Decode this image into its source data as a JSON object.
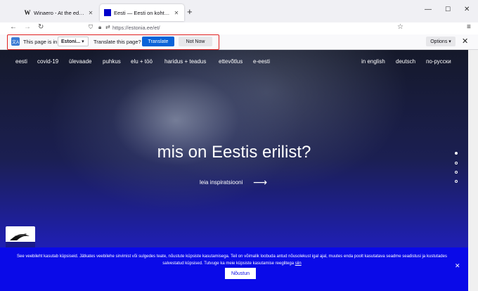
{
  "browser": {
    "tabs": [
      {
        "title": "Winaero - At the edge of tweaki",
        "icon": "winaero-favicon",
        "active": false
      },
      {
        "title": "Eesti — Eesti on koht iseseisval",
        "icon": "estonia-favicon",
        "active": true
      }
    ],
    "new_tab": "+",
    "url": "https://estonia.ee/et/"
  },
  "translate_bar": {
    "prefix": "This page is in",
    "language": "Estoni...",
    "question": "Translate this page?",
    "translate_label": "Translate",
    "not_now_label": "Not Now",
    "options_label": "Options",
    "highlight_color": "#e02020"
  },
  "site": {
    "nav_left": [
      "eesti",
      "covid-19",
      "ülevaade",
      "puhkus",
      "elu + töö",
      "haridus + teadus",
      "ettevõtlus",
      "e-eesti"
    ],
    "nav_right": [
      "in english",
      "deutsch",
      "по-русски"
    ],
    "hero_title": "mis on Eestis erilist?",
    "hero_link": "leia inspiratsiooni",
    "slide_count": 4,
    "active_slide": 1
  },
  "cookie_banner": {
    "text": "See veebileht kasutab küpsiseid. Jätkates veebilehe sirvimist või sulgedes teate, nõustute küpsiste kasutamisega. Teil on võimalik loobuda antud nõusolekust igal ajal, muutes enda poolt kasutatava seadme seadistusi ja kustutades salvestatud küpsised. Tutvuge ka meie küpsiste kasutamise reeglitega",
    "link": "siin",
    "button": "Nõustun",
    "background": "#0a0ae8"
  }
}
